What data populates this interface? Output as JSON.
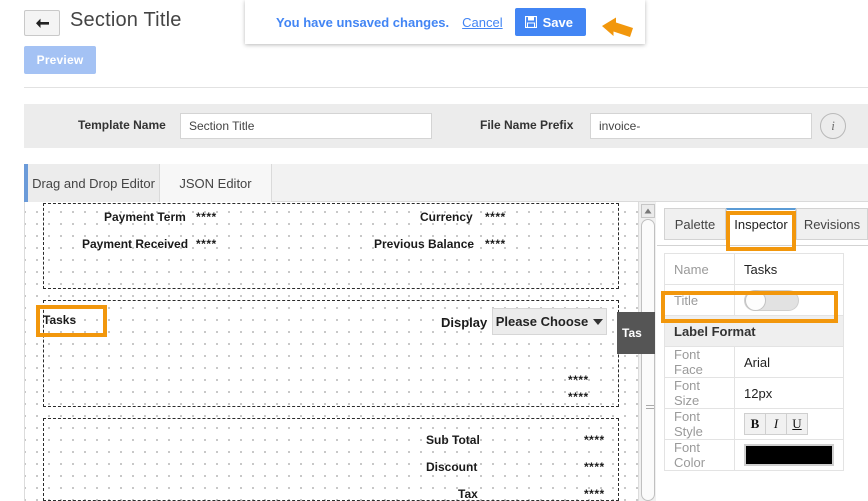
{
  "header": {
    "back_icon": "back-arrow-icon",
    "title": "Section Title",
    "preview_label": "Preview"
  },
  "toast": {
    "message": "You have unsaved changes.",
    "cancel_label": "Cancel",
    "save_label": "Save",
    "save_icon": "floppy-disk-icon",
    "pointer_icon": "orange-arrow-icon",
    "link_color": "#4285f4",
    "button_color": "#4285f4"
  },
  "meta": {
    "template_name_label": "Template Name",
    "template_name_value": "Section Title",
    "file_name_prefix_label": "File Name Prefix",
    "file_name_prefix_value": "invoice-",
    "info_icon": "info-circle-icon"
  },
  "editor_tabs": [
    {
      "label": "Drag and Drop Editor",
      "active": true
    },
    {
      "label": "JSON Editor",
      "active": false
    }
  ],
  "canvas": {
    "top_section": [
      {
        "label": "Payment Term",
        "value": "****"
      },
      {
        "label": "Currency",
        "value": "****"
      },
      {
        "label": "Payment Received",
        "value": "****"
      },
      {
        "label": "Previous Balance",
        "value": "****"
      }
    ],
    "tasks_label": "Tasks",
    "display_label": "Display",
    "display_value": "Please Choose",
    "drag_chip_label": "Tas",
    "mid_values": [
      "****",
      "****"
    ],
    "bottom_section": [
      {
        "label": "Sub Total",
        "value": "****"
      },
      {
        "label": "Discount",
        "value": "****"
      },
      {
        "label": "Tax",
        "value": "****"
      }
    ]
  },
  "scrollbar": {
    "up_arrow_icon": "scroll-up-arrow-icon"
  },
  "panel": {
    "tabs": [
      {
        "label": "Palette",
        "active": false
      },
      {
        "label": "Inspector",
        "active": true
      },
      {
        "label": "Revisions",
        "active": false
      }
    ],
    "rows": [
      {
        "key": "Name",
        "value": "Tasks"
      },
      {
        "key": "Title",
        "value": ""
      }
    ],
    "title_toggle_state": "off",
    "label_format_heading": "Label Format",
    "format_rows": [
      {
        "key": "Font Face",
        "value": "Arial"
      },
      {
        "key": "Font Size",
        "value": "12px"
      },
      {
        "key": "Font Style",
        "value": ""
      },
      {
        "key": "Font Color",
        "value": ""
      }
    ],
    "font_style_buttons": [
      "B",
      "I",
      "U"
    ],
    "font_color_value": "#000000"
  },
  "highlights": {
    "color": "#f2970c",
    "targets": [
      "inspector-tab",
      "title-row",
      "tasks-label"
    ]
  }
}
